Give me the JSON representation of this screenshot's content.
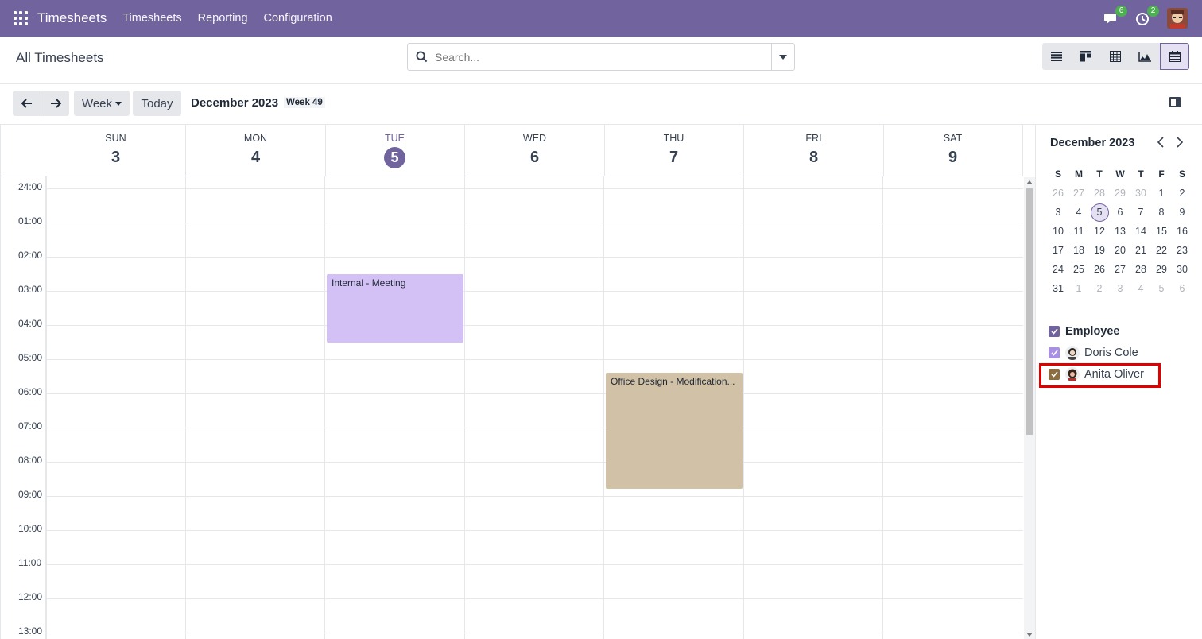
{
  "navbar": {
    "brand": "Timesheets",
    "menu": [
      "Timesheets",
      "Reporting",
      "Configuration"
    ],
    "messages_count": "6",
    "activities_count": "2",
    "bg_color": "#71639e"
  },
  "control_panel": {
    "breadcrumb": "All Timesheets",
    "search_placeholder": "Search...",
    "views": [
      "list-view-icon",
      "kanban-view-icon",
      "pivot-view-icon",
      "graph-view-icon",
      "calendar-view-icon"
    ],
    "active_view": "calendar"
  },
  "toolbar": {
    "scale_label": "Week",
    "today_label": "Today",
    "title": "December 2023",
    "week_label": "Week 49"
  },
  "calendar": {
    "days": [
      {
        "name": "SUN",
        "date": "3"
      },
      {
        "name": "MON",
        "date": "4"
      },
      {
        "name": "TUE",
        "date": "5",
        "today": true
      },
      {
        "name": "WED",
        "date": "6"
      },
      {
        "name": "THU",
        "date": "7"
      },
      {
        "name": "FRI",
        "date": "8"
      },
      {
        "name": "SAT",
        "date": "9"
      }
    ],
    "hours": [
      "24:00",
      "01:00",
      "02:00",
      "03:00",
      "04:00",
      "05:00",
      "06:00",
      "07:00",
      "08:00",
      "09:00",
      "10:00",
      "11:00",
      "12:00",
      "13:00"
    ],
    "events": [
      {
        "title": "Internal - Meeting",
        "day_index": 2,
        "start_hour": 2.5,
        "end_hour": 4.5,
        "color": "#d3c0f4"
      },
      {
        "title": "Office Design - Modification...",
        "day_index": 4,
        "start_hour": 5.4,
        "end_hour": 8.8,
        "color": "#d1c1a6"
      }
    ]
  },
  "sidebar": {
    "mini_title": "December 2023",
    "weekdays": [
      "S",
      "M",
      "T",
      "W",
      "T",
      "F",
      "S"
    ],
    "weeks": [
      [
        "26",
        "27",
        "28",
        "29",
        "30",
        "1",
        "2"
      ],
      [
        "3",
        "4",
        "5",
        "6",
        "7",
        "8",
        "9"
      ],
      [
        "10",
        "11",
        "12",
        "13",
        "14",
        "15",
        "16"
      ],
      [
        "17",
        "18",
        "19",
        "20",
        "21",
        "22",
        "23"
      ],
      [
        "24",
        "25",
        "26",
        "27",
        "28",
        "29",
        "30"
      ],
      [
        "31",
        "1",
        "2",
        "3",
        "4",
        "5",
        "6"
      ]
    ],
    "filter_title": "Employee",
    "employees": [
      {
        "name": "Doris Cole",
        "color": "#a98ee5"
      },
      {
        "name": "Anita Oliver",
        "color": "#8c6d3f"
      }
    ]
  }
}
